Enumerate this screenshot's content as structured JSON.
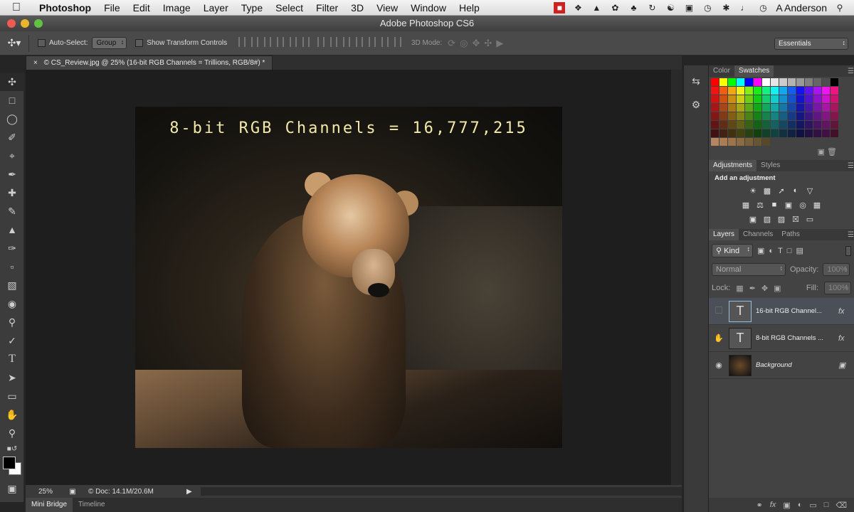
{
  "menubar": {
    "app": "Photoshop",
    "items": [
      "File",
      "Edit",
      "Image",
      "Layer",
      "Type",
      "Select",
      "Filter",
      "3D",
      "View",
      "Window",
      "Help"
    ],
    "user": "A Anderson"
  },
  "window": {
    "title": "Adobe Photoshop CS6"
  },
  "options": {
    "auto_select_label": "Auto-Select:",
    "auto_select_value": "Group",
    "transform_label": "Show Transform Controls",
    "mode_3d_label": "3D Mode:",
    "workspace": "Essentials"
  },
  "document": {
    "tab_title": "© CS_Review.jpg @ 25% (16-bit RGB Channels = Trillions, RGB/8#) *",
    "caption": "8-bit RGB Channels = 16,777,215"
  },
  "status": {
    "zoom": "25%",
    "doc": "© Doc: 14.1M/20.6M"
  },
  "bottom_tabs": [
    "Mini Bridge",
    "Timeline"
  ],
  "panels": {
    "color_tabs": [
      "Color",
      "Swatches"
    ],
    "adjust_tabs": [
      "Adjustments",
      "Styles"
    ],
    "add_adjustment": "Add an adjustment",
    "layers_tabs": [
      "Layers",
      "Channels",
      "Paths"
    ],
    "filter_kind": "Kind",
    "blend_mode": "Normal",
    "opacity_label": "Opacity:",
    "opacity_value": "100%",
    "lock_label": "Lock:",
    "fill_label": "Fill:",
    "fill_value": "100%",
    "layers": [
      {
        "name": "16-bit RGB Channel...",
        "type": "T"
      },
      {
        "name": "8-bit RGB Channels ...",
        "type": "T"
      },
      {
        "name": "Background",
        "type": "image"
      }
    ]
  },
  "colors": {
    "swatches_row1": [
      "#ff0000",
      "#ffff00",
      "#00ff00",
      "#00ffff",
      "#0000ff",
      "#ff00ff",
      "#ffffff",
      "#e6e6e6",
      "#cccccc",
      "#b3b3b3",
      "#999999",
      "#808080",
      "#666666",
      "#4d4d4d",
      "#000000"
    ]
  }
}
